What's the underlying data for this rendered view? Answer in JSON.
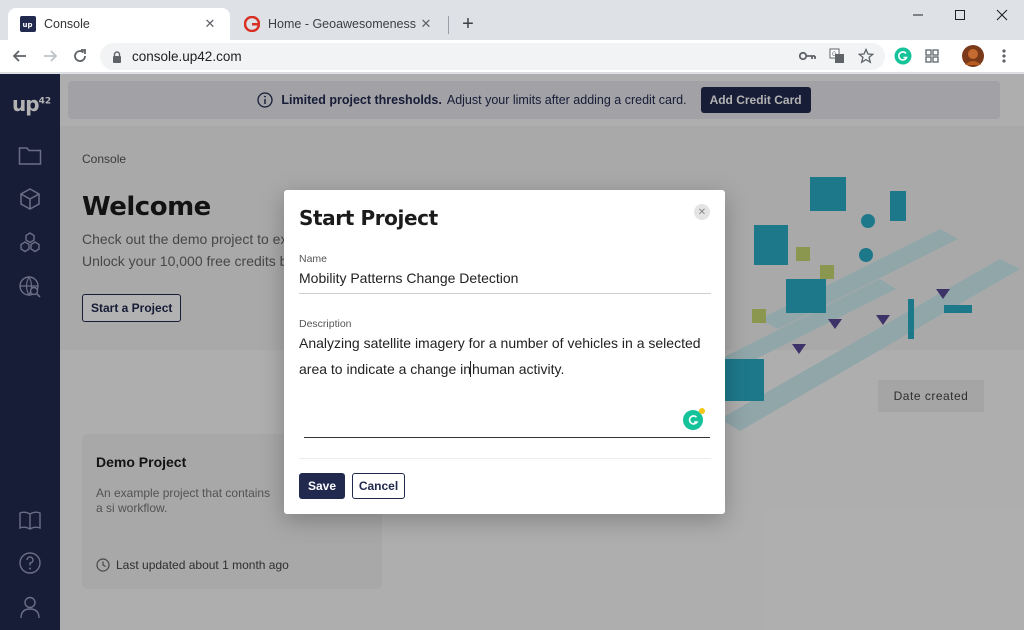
{
  "browser": {
    "tabs": [
      {
        "title": "Console",
        "favicon": "up42-favicon",
        "active": true
      },
      {
        "title": "Home - Geoawesomeness",
        "favicon": "geoawesomeness-favicon",
        "active": false
      }
    ],
    "url": "console.up42.com"
  },
  "sidebar": {
    "logo_text": "up",
    "logo_sup": "42",
    "icons": [
      "folder-icon",
      "cube-icon",
      "blocks-icon",
      "globe-search-icon",
      "book-icon",
      "help-icon",
      "user-icon"
    ]
  },
  "banner": {
    "bold": "Limited project thresholds.",
    "text": "Adjust your limits after adding a credit card.",
    "button": "Add Credit Card"
  },
  "page": {
    "breadcrumb": "Console",
    "title": "Welcome",
    "line1": "Check out the demo project to ex",
    "line2": "Unlock your 10,000 free credits by",
    "start_button": "Start a Project",
    "date_chip": "Date created"
  },
  "card": {
    "title": "Demo Project",
    "desc": "An example project that contains a si workflow.",
    "updated": "Last updated about 1 month ago"
  },
  "modal": {
    "title": "Start Project",
    "name_label": "Name",
    "name_value": "Mobility Patterns Change Detection",
    "description_label": "Description",
    "description_part1": "Analyzing satellite imagery for a number of vehicles in a selected area to indicate a change in",
    "description_part2": "human activity.",
    "save": "Save",
    "cancel": "Cancel"
  },
  "colors": {
    "brand_navy": "#22294f",
    "grammarly_green": "#15c39a",
    "illustration_teal": "#2aaec6"
  }
}
